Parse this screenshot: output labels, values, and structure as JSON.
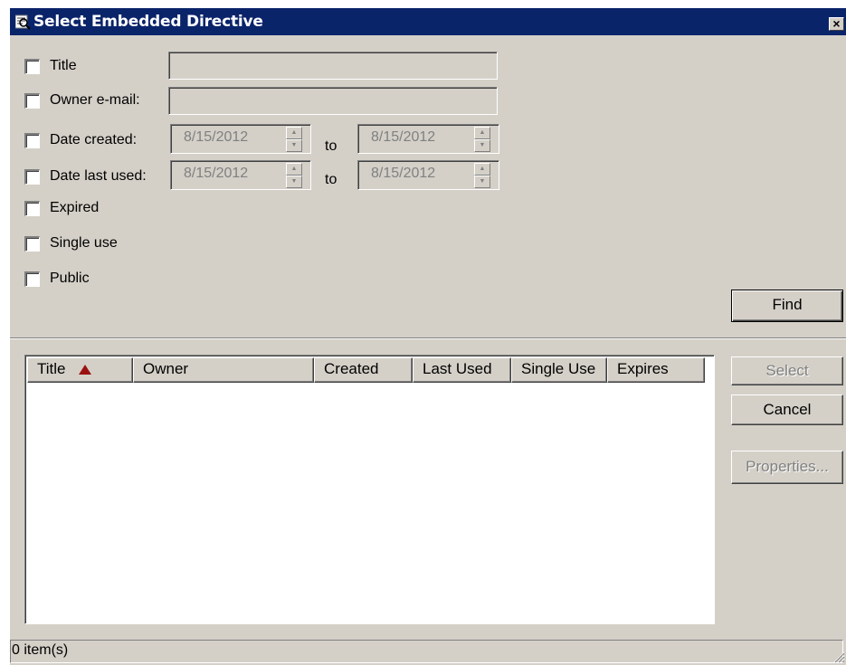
{
  "window": {
    "title": "Select Embedded Directive",
    "close_label": "×"
  },
  "icons": {
    "title": "search-directive-icon",
    "close": "close-icon",
    "sort": "sort-ascending-icon",
    "spin_up": "spin-up-icon",
    "spin_down": "spin-down-icon",
    "grip": "resize-grip-icon"
  },
  "colors": {
    "titlebar": "#0a246a",
    "face": "#d4d0c8",
    "sort_arrow": "#9b1111",
    "disabled_text": "#808080"
  },
  "filters": {
    "title": {
      "label": "Title",
      "checked": false,
      "value": ""
    },
    "owner_email": {
      "label": "Owner e-mail:",
      "checked": false,
      "value": ""
    },
    "date_created": {
      "label": "Date created:",
      "checked": false,
      "from": "8/15/2012",
      "to_label": "to",
      "to": "8/15/2012"
    },
    "date_last_used": {
      "label": "Date last used:",
      "checked": false,
      "from": "8/15/2012",
      "to_label": "to",
      "to": "8/15/2012"
    },
    "expired": {
      "label": "Expired",
      "checked": false
    },
    "single_use": {
      "label": "Single use",
      "checked": false
    },
    "public": {
      "label": "Public",
      "checked": false
    }
  },
  "buttons": {
    "find": "Find",
    "select": "Select",
    "cancel": "Cancel",
    "properties": "Properties..."
  },
  "list": {
    "columns": [
      "Title",
      "Owner",
      "Created",
      "Last Used",
      "Single Use",
      "Expires"
    ],
    "sort_column": "Title",
    "sort_direction": "ascending",
    "rows": []
  },
  "status": {
    "text": "0 item(s)"
  }
}
